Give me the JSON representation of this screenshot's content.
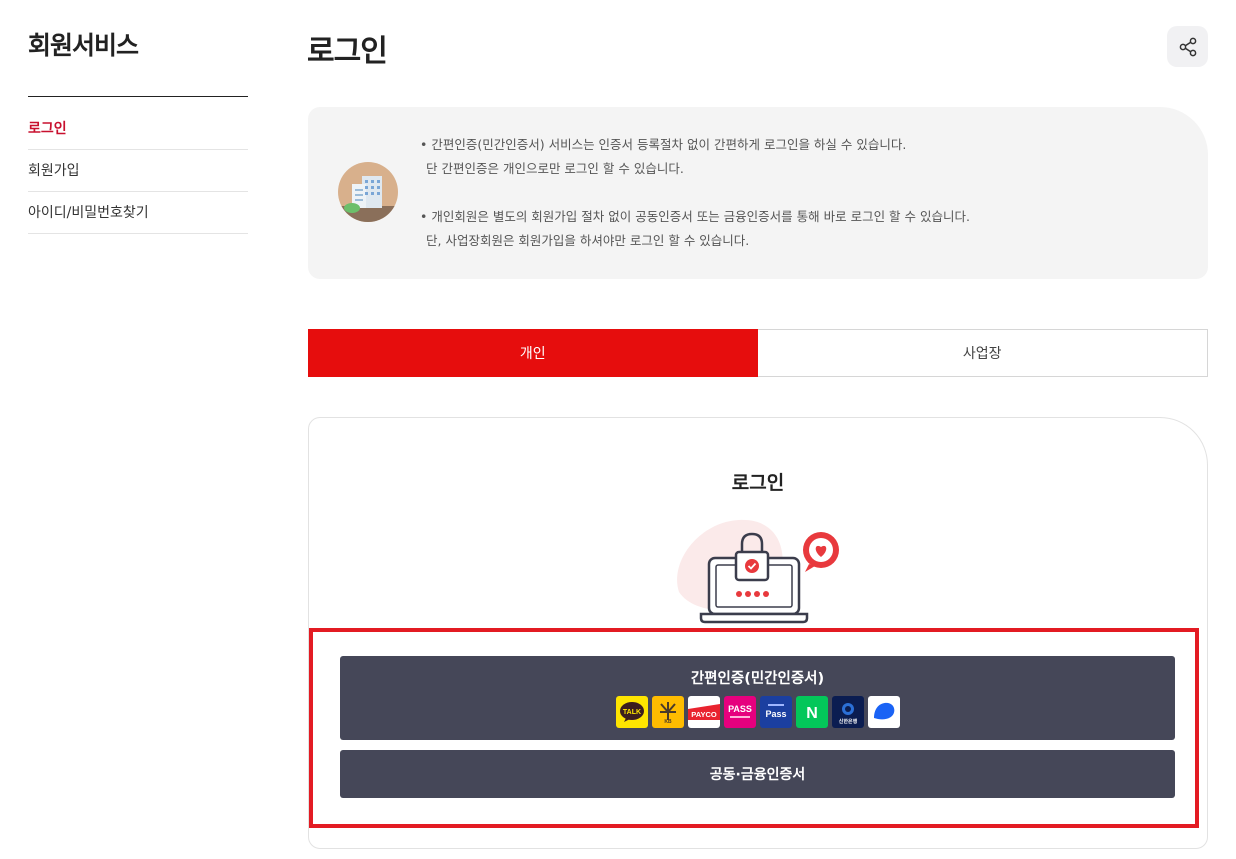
{
  "sidebar": {
    "title": "회원서비스",
    "items": [
      {
        "label": "로그인",
        "active": true
      },
      {
        "label": "회원가입",
        "active": false
      },
      {
        "label": "아이디/비밀번호찾기",
        "active": false
      }
    ]
  },
  "header": {
    "title": "로그인",
    "share_icon": "share-icon"
  },
  "notice": {
    "icon": "building-icon",
    "lines": [
      "• 간편인증(민간인증서) 서비스는 인증서 등록절차 없이 간편하게 로그인을 하실 수 있습니다.",
      "단 간편인증은 개인으로만 로그인 할 수 있습니다.",
      "• 개인회원은 별도의 회원가입 절차 없이 공동인증서 또는 금융인증서를 통해 바로 로그인 할 수 있습니다.",
      "단, 사업장회원은 회원가입을 하셔야만 로그인 할 수 있습니다."
    ]
  },
  "tabs": [
    {
      "label": "개인",
      "active": true
    },
    {
      "label": "사업장",
      "active": false
    }
  ],
  "login": {
    "title": "로그인",
    "illustration": "laptop-lock-icon",
    "simple_auth_label": "간편인증(민간인증서)",
    "providers": [
      {
        "name": "kakao",
        "text": "TALK",
        "color": "#fee500"
      },
      {
        "name": "kb",
        "text": "KB",
        "color": "#ffbc00"
      },
      {
        "name": "payco",
        "text": "PAYCO",
        "color": "#ffffff"
      },
      {
        "name": "pass",
        "text": "PASS",
        "color": "#e6007e"
      },
      {
        "name": "samsung-pass",
        "text": "Pass",
        "color": "#1b3fa0"
      },
      {
        "name": "naver",
        "text": "N",
        "color": "#03c75a"
      },
      {
        "name": "shinhan",
        "text": "신한은행",
        "color": "#0b1d51"
      },
      {
        "name": "toss",
        "text": "",
        "color": "#ffffff"
      }
    ],
    "cert_auth_label": "공동·금융인증서"
  },
  "colors": {
    "accent": "#e60d0d",
    "active_text": "#c8102e",
    "button": "#454758",
    "highlight": "#e31b23"
  }
}
